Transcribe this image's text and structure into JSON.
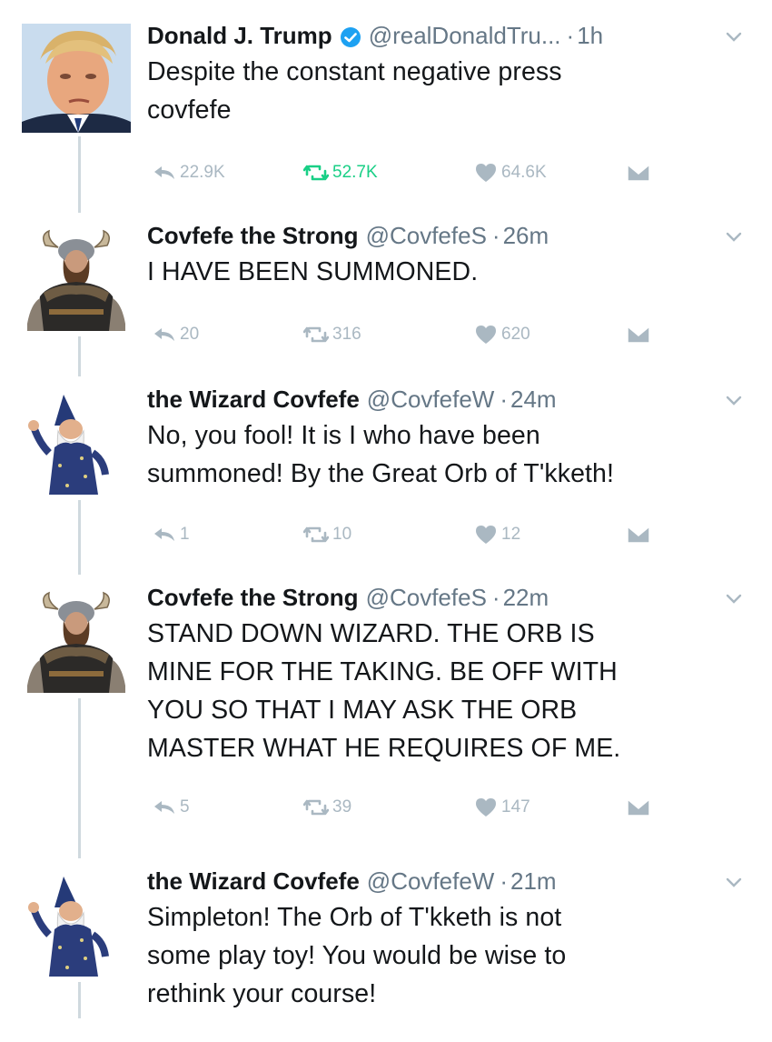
{
  "thread": {
    "tweets": [
      {
        "author": "Donald J. Trump",
        "verified": true,
        "handle": "@realDonaldTru...",
        "separator": "·",
        "time": "1h",
        "lines": [
          "Despite the constant negative press",
          "covfefe"
        ],
        "avatar": "trump-portrait",
        "replies": "22.9K",
        "retweets": "52.7K",
        "likes": "64.6K",
        "retweeted": true
      },
      {
        "author": "Covfefe the Strong",
        "verified": false,
        "handle": "@CovfefeS",
        "separator": "·",
        "time": "26m",
        "lines": [
          "I HAVE BEEN SUMMONED."
        ],
        "avatar": "viking-warrior",
        "replies": "20",
        "retweets": "316",
        "likes": "620",
        "retweeted": false
      },
      {
        "author": "the Wizard Covfefe",
        "verified": false,
        "handle": "@CovfefeW",
        "separator": "·",
        "time": "24m",
        "lines": [
          "No, you fool! It is I who have been",
          "summoned! By the Great Orb of T'kketh!"
        ],
        "avatar": "bearded-wizard",
        "replies": "1",
        "retweets": "10",
        "likes": "12",
        "retweeted": false
      },
      {
        "author": "Covfefe the Strong",
        "verified": false,
        "handle": "@CovfefeS",
        "separator": "·",
        "time": "22m",
        "lines": [
          "STAND DOWN WIZARD. THE ORB IS",
          "MINE FOR THE TAKING. BE OFF WITH",
          "YOU SO THAT I MAY ASK THE ORB",
          "MASTER WHAT HE REQUIRES OF ME."
        ],
        "avatar": "viking-warrior",
        "replies": "5",
        "retweets": "39",
        "likes": "147",
        "retweeted": false
      },
      {
        "author": "the Wizard Covfefe",
        "verified": false,
        "handle": "@CovfefeW",
        "separator": "·",
        "time": "21m",
        "lines": [
          "Simpleton! The Orb of T'kketh is not",
          "some play toy! You would be wise to",
          "rethink your course!"
        ],
        "avatar": "bearded-wizard",
        "replies": null,
        "retweets": null,
        "likes": null,
        "retweeted": false
      }
    ]
  },
  "colors": {
    "text": "#14171a",
    "muted": "#657786",
    "action_gray": "#aab8c2",
    "retweet_green": "#19cf86",
    "verified_blue": "#1da1f2",
    "thread_line": "#cfd9de"
  }
}
